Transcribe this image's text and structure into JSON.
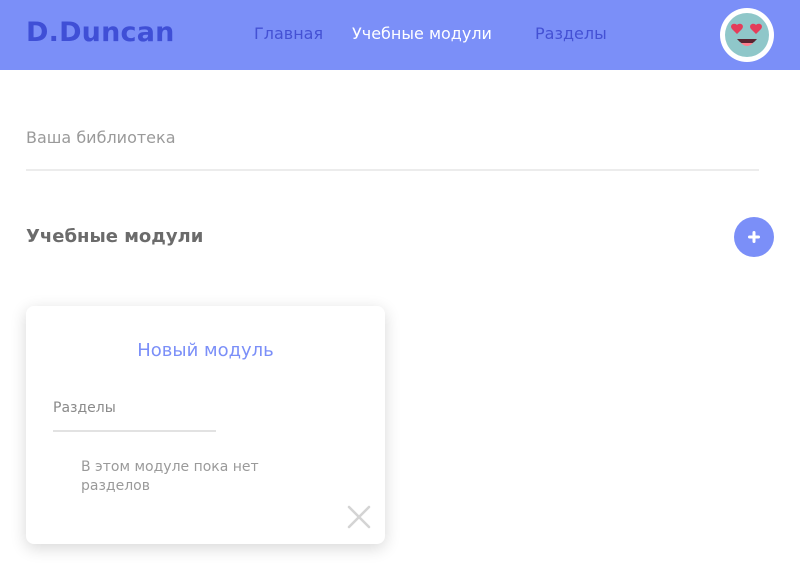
{
  "header": {
    "brand": "D.Duncan",
    "nav": [
      {
        "label": "Главная",
        "active": false
      },
      {
        "label": "Учебные модули",
        "active": true
      },
      {
        "label": "Разделы",
        "active": false
      }
    ],
    "avatar_icon": "heart-eyes-face-icon"
  },
  "library": {
    "label": "Ваша библиотека"
  },
  "modules_section": {
    "title": "Учебные модули",
    "add_icon": "plus-icon"
  },
  "module_card": {
    "title": "Новый модуль",
    "sections_label": "Разделы",
    "empty_text": "В этом модуле пока нет разделов",
    "close_icon": "close-icon"
  },
  "colors": {
    "accent": "#7b8ff8",
    "brand": "#3f4fd6",
    "nav_text": "#4451d4",
    "muted_text": "#9a9a9a"
  }
}
